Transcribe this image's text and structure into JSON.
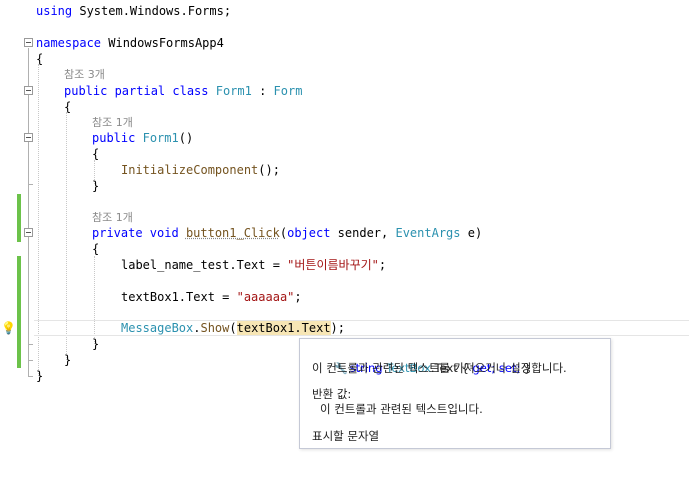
{
  "code": {
    "using_kw": "using",
    "using_ns": " System.Windows.Forms;",
    "namespace_kw": "namespace",
    "namespace_name": " WindowsFormsApp4",
    "open_brace": "{",
    "close_brace": "}",
    "class_refs": "참조 3개",
    "class_kw": "public partial class",
    "class_name": "Form1",
    "class_colon": " : ",
    "class_base": "Form",
    "ctor_refs": "참조 1개",
    "ctor_kw": "public",
    "ctor_name": "Form1",
    "ctor_parens": "()",
    "init_call": "InitializeComponent",
    "init_tail": "();",
    "handler_refs": "참조 1개",
    "handler_kw": "private void",
    "handler_name": "button1_Click",
    "handler_open": "(",
    "handler_obj_kw": "object",
    "handler_sender": " sender, ",
    "handler_eventargs": "EventArgs",
    "handler_e": " e)",
    "label_stmt": "label_name_test.Text = ",
    "label_str": "\"버튼이름바꾸기\"",
    "label_end": ";",
    "textbox_stmt": "textBox1.Text = ",
    "textbox_str": "\"aaaaaa\"",
    "textbox_end": ";",
    "msg_type": "MessageBox",
    "msg_dot": ".",
    "msg_method": "Show",
    "msg_open": "(",
    "msg_arg": "textBox1.Text",
    "msg_close": ");"
  },
  "tooltip": {
    "type_kw": "string",
    "member_class": "TextBox",
    "member_name": ".Text { ",
    "get_kw": "get;",
    "set_kw": " set;",
    "close": " }",
    "summary": "이 컨트롤과 관련된 텍스트를 가져오거나 설정합니다.",
    "returns_label": "반환 값:",
    "returns_desc": "이 컨트롤과 관련된 텍스트입니다.",
    "remarks": "표시할 문자열"
  },
  "icons": {
    "lightbulb": "lightbulb-icon",
    "wrench": "wrench-icon"
  },
  "colors": {
    "keyword": "#0000ff",
    "type": "#2b91af",
    "string": "#a31515",
    "method": "#74531f",
    "change_bar": "#6cc24a"
  }
}
